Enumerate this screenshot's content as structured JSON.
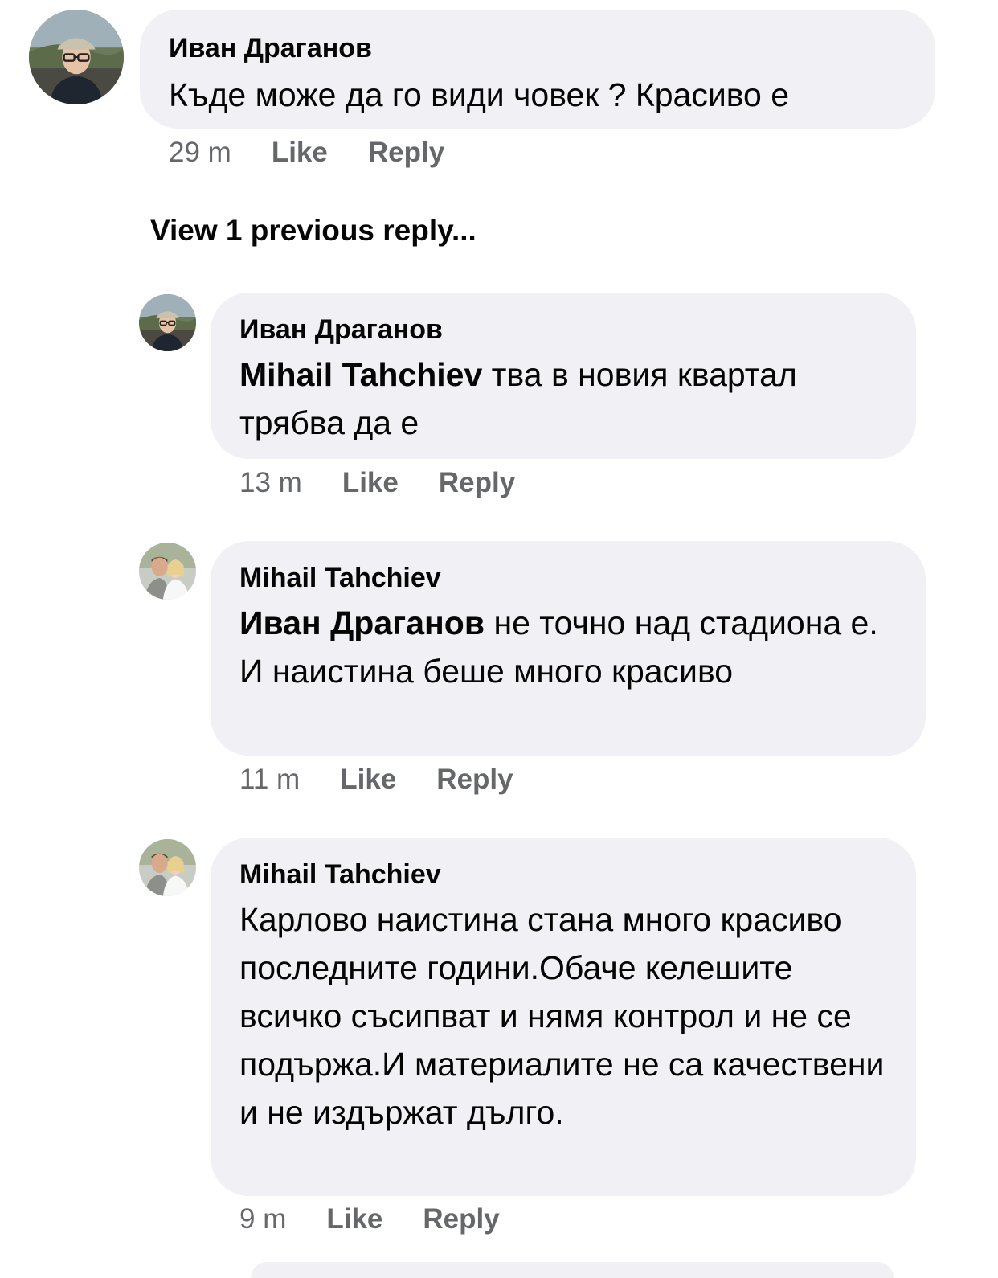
{
  "comments": [
    {
      "author": "Иван Драганов",
      "mention": "",
      "text": "Къде може да го види човек ? Красиво е",
      "time": "29 m",
      "like_label": "Like",
      "reply_label": "Reply",
      "avatar_icon": "avatar-man-cap-glasses"
    },
    {
      "author": "Иван Драганов",
      "mention": "Mihail Tahchiev",
      "text": " тва в новия квартал трябва да е",
      "time": "13 m",
      "like_label": "Like",
      "reply_label": "Reply",
      "avatar_icon": "avatar-man-cap-glasses"
    },
    {
      "author": "Mihail Tahchiev",
      "mention": "Иван Драганов",
      "text": " не точно над стадиона е. И наистина беше много красиво",
      "time": "11 m",
      "like_label": "Like",
      "reply_label": "Reply",
      "avatar_icon": "avatar-couple"
    },
    {
      "author": "Mihail Tahchiev",
      "mention": "",
      "text": "Карлово наистина стана много красиво последните години.Обаче келешите всичко съсипват и нямя контрол и не се подържа.И материалите не са качествени и не издържат дълго.",
      "time": "9 m",
      "like_label": "Like",
      "reply_label": "Reply",
      "avatar_icon": "avatar-couple"
    }
  ],
  "view_previous": "View 1 previous reply...",
  "colors": {
    "bubble": "#f0f0f5",
    "meta_text": "#65676b",
    "primary_text": "#050505"
  }
}
